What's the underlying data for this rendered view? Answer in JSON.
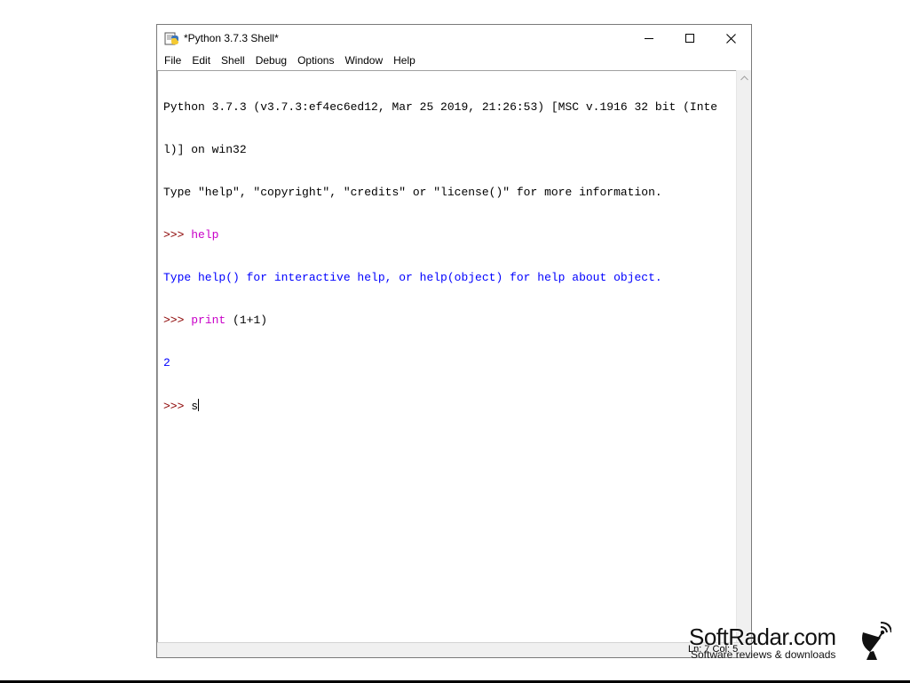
{
  "window": {
    "title": "*Python 3.7.3 Shell*",
    "icon": "python-idle-icon"
  },
  "menu": [
    "File",
    "Edit",
    "Shell",
    "Debug",
    "Options",
    "Window",
    "Help"
  ],
  "shell": {
    "banner_line1": "Python 3.7.3 (v3.7.3:ef4ec6ed12, Mar 25 2019, 21:26:53) [MSC v.1916 32 bit (Inte",
    "banner_line2": "l)] on win32",
    "banner_line3": "Type \"help\", \"copyright\", \"credits\" or \"license()\" for more information.",
    "prompt": ">>> ",
    "cmd1": "help",
    "help_output": "Type help() for interactive help, or help(object) for help about object.",
    "cmd2_keyword": "print",
    "cmd2_rest": " (1+1)",
    "result": "2",
    "current_input": "s"
  },
  "status": {
    "text": "Ln: 7  Col: 5"
  },
  "watermark": {
    "title": "SoftRadar.com",
    "subtitle": "Software reviews & downloads",
    "icon": "satellite-dish-icon"
  },
  "colors": {
    "prompt": "#8b0000",
    "keyword": "#c800c8",
    "output": "#0000ff",
    "text": "#000000"
  }
}
